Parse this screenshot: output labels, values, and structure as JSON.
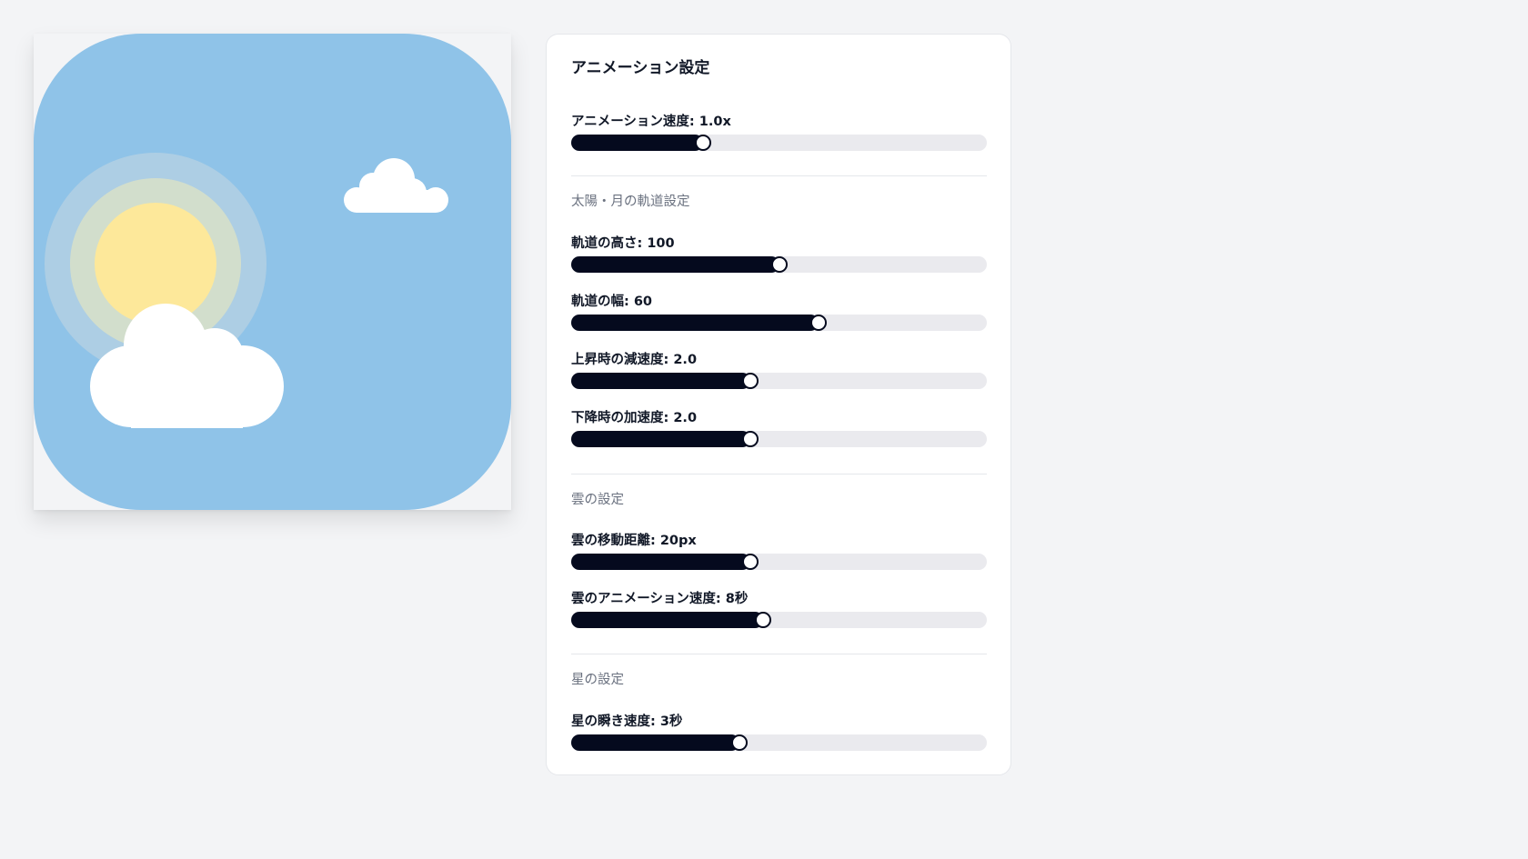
{
  "title": "アニメーション設定",
  "colors": {
    "sky": "#8fc3e8",
    "sun_core": "#fde89a",
    "sun_glow": "#f3f2b8",
    "cloud": "#ffffff",
    "track": "#eaeaee",
    "fill": "#050a1e"
  },
  "general": {
    "controls": [
      {
        "label": "アニメーション速度: 1.0x",
        "fraction": 0.317
      }
    ]
  },
  "orbit": {
    "heading": "太陽・月の軌道設定",
    "controls": [
      {
        "label": "軌道の高さ: 100",
        "fraction": 0.5
      },
      {
        "label": "軌道の幅: 60",
        "fraction": 0.596
      },
      {
        "label": "上昇時の減速度: 2.0",
        "fraction": 0.43
      },
      {
        "label": "下降時の加速度: 2.0",
        "fraction": 0.43
      }
    ]
  },
  "clouds": {
    "heading": "雲の設定",
    "controls": [
      {
        "label": "雲の移動距離: 20px",
        "fraction": 0.43
      },
      {
        "label": "雲のアニメーション速度: 8秒",
        "fraction": 0.462
      }
    ]
  },
  "stars": {
    "heading": "星の設定",
    "controls": [
      {
        "label": "星の瞬き速度: 3秒",
        "fraction": 0.404
      }
    ]
  }
}
